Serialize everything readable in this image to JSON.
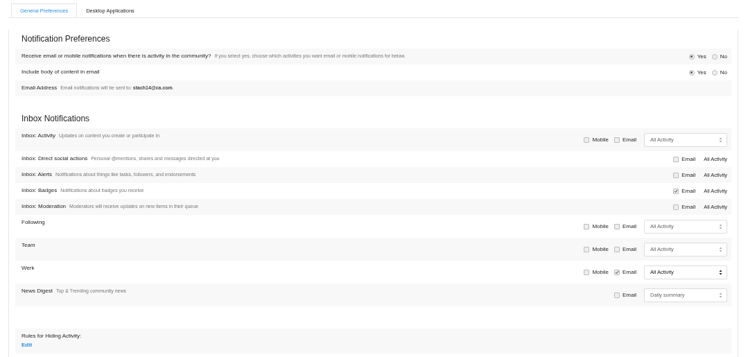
{
  "tabs": [
    {
      "label": "General Preferences",
      "selected": true
    },
    {
      "label": "Desktop Applications",
      "selected": false
    }
  ],
  "notification_preferences": {
    "title": "Notification Preferences",
    "rows": [
      {
        "kind": "radio",
        "label": "Receive email or mobile notifications when there is activity in the community?",
        "hint": "If you select yes, choose which activities you want email or mobile notifications for below.",
        "options": [
          {
            "label": "Yes",
            "selected": true
          },
          {
            "label": "No",
            "selected": false
          }
        ]
      },
      {
        "kind": "radio",
        "label": "Include body of content in email",
        "options": [
          {
            "label": "Yes",
            "selected": true
          },
          {
            "label": "No",
            "selected": false
          }
        ]
      },
      {
        "kind": "info",
        "label": "Email Address",
        "hint": "Email notifications will be sent to: **stach14@ca.com**."
      }
    ]
  },
  "inbox_notifications": {
    "title": "Inbox Notifications",
    "rows": [
      {
        "label": "Inbox: Activity",
        "hint": "Updates on content you create or participate in",
        "mobile": {
          "label": "Mobile",
          "checked": false
        },
        "email": {
          "label": "Email",
          "checked": false
        },
        "select": {
          "value": "All Activity",
          "disabled": true
        }
      },
      {
        "label": "Inbox: Direct social actions",
        "hint": "Personal @mentions, shares and messages directed at you",
        "email": {
          "label": "Email",
          "checked": false
        },
        "frequency": "All Activity"
      },
      {
        "label": "Inbox: Alerts",
        "hint": "Notifications about things like tasks, followers, and endorsements",
        "email": {
          "label": "Email",
          "checked": false
        },
        "frequency": "All Activity"
      },
      {
        "label": "Inbox: Badges",
        "hint": "Notifications about badges you receive",
        "email": {
          "label": "Email",
          "checked": true
        },
        "frequency": "All Activity"
      },
      {
        "label": "Inbox: Moderation",
        "hint": "Moderators will receive updates on new items in their queue",
        "email": {
          "label": "Email",
          "checked": false
        },
        "frequency": "All Activity"
      },
      {
        "label": "Following",
        "mobile": {
          "label": "Mobile",
          "checked": false
        },
        "email": {
          "label": "Email",
          "checked": false
        },
        "select": {
          "value": "All Activity",
          "disabled": true
        }
      },
      {
        "label": "Team",
        "mobile": {
          "label": "Mobile",
          "checked": false
        },
        "email": {
          "label": "Email",
          "checked": false
        },
        "select": {
          "value": "All Activity",
          "disabled": true
        }
      },
      {
        "label": "Werk",
        "mobile": {
          "label": "Mobile",
          "checked": false
        },
        "email": {
          "label": "Email",
          "checked": true
        },
        "select": {
          "value": "All Activity",
          "disabled": false
        }
      },
      {
        "label": "News Digest",
        "hint": "Top & Trending community news",
        "email": {
          "label": "Email",
          "checked": false
        },
        "select": {
          "value": "Daily summary",
          "disabled": true
        }
      }
    ]
  },
  "hiding_rules": {
    "label": "Rules for Hiding Activity:",
    "link": "Edit"
  }
}
